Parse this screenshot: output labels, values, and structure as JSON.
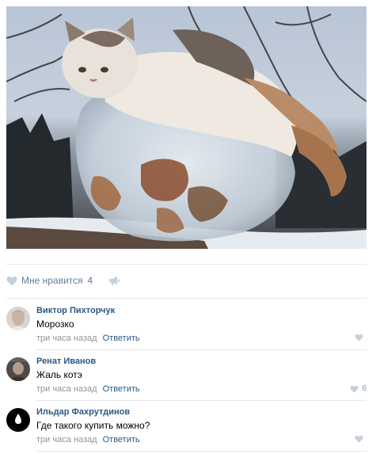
{
  "post": {
    "image_alt_icon": "photo-cat-in-ice"
  },
  "likes": {
    "label": "Мне нравится",
    "count": "4",
    "heart_color": "#c5d0db",
    "share_icon": "megaphone-icon"
  },
  "comments": [
    {
      "author": "Виктор Пихторчук",
      "text": "Морозко",
      "time": "три часа назад",
      "reply": "Ответить",
      "likes": ""
    },
    {
      "author": "Ренат Иванов",
      "text": "Жаль котэ",
      "time": "три часа назад",
      "reply": "Ответить",
      "likes": "6"
    },
    {
      "author": "Ильдар Фахрутдинов",
      "text": "Где такого купить можно?",
      "time": "три часа назад",
      "reply": "Ответить",
      "likes": ""
    }
  ],
  "colors": {
    "link": "#2a5885",
    "muted": "#939393",
    "divider": "#e7e8ec"
  }
}
